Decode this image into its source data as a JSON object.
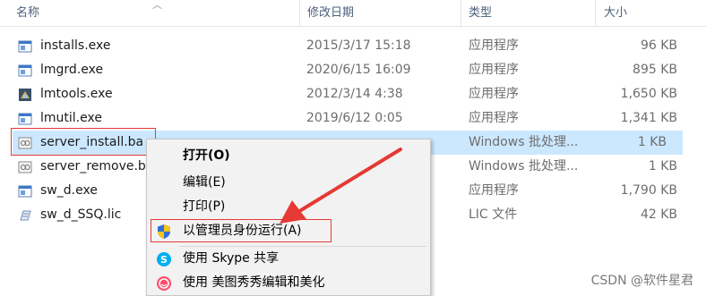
{
  "columns": {
    "name": "名称",
    "date": "修改日期",
    "type": "类型",
    "size": "大小"
  },
  "files": [
    {
      "name": "installs.exe",
      "date": "2015/3/17 15:18",
      "type": "应用程序",
      "size": "96 KB",
      "icon": "exe-icon"
    },
    {
      "name": "lmgrd.exe",
      "date": "2020/6/15 16:09",
      "type": "应用程序",
      "size": "895 KB",
      "icon": "exe-icon"
    },
    {
      "name": "lmtools.exe",
      "date": "2012/3/14 4:38",
      "type": "应用程序",
      "size": "1,650 KB",
      "icon": "lmtools-icon"
    },
    {
      "name": "lmutil.exe",
      "date": "2019/6/12 0:05",
      "type": "应用程序",
      "size": "1,341 KB",
      "icon": "exe-icon"
    },
    {
      "name": "server_install.ba",
      "date": "",
      "type": "Windows 批处理...",
      "size": "1 KB",
      "icon": "batch-file-icon",
      "selected": true
    },
    {
      "name": "server_remove.b",
      "date": "",
      "type": "Windows 批处理...",
      "size": "1 KB",
      "icon": "batch-file-icon"
    },
    {
      "name": "sw_d.exe",
      "date": "",
      "type": "应用程序",
      "size": "1,790 KB",
      "icon": "exe-icon"
    },
    {
      "name": "sw_d_SSQ.lic",
      "date": "",
      "type": "LIC 文件",
      "size": "42 KB",
      "icon": "lic-file-icon"
    }
  ],
  "context_menu": {
    "items": [
      {
        "label": "打开(O)",
        "bold": true
      },
      {
        "label": "编辑(E)"
      },
      {
        "label": "打印(P)"
      },
      {
        "label": "以管理员身份运行(A)",
        "icon": "uac-shield-icon"
      },
      {
        "label": "使用 Skype 共享",
        "icon": "skype-icon"
      },
      {
        "label": "使用 美图秀秀编辑和美化",
        "icon": "meitu-icon"
      }
    ]
  },
  "watermark": "CSDN @软件星君",
  "colors": {
    "selection": "#cce8ff",
    "annotation_red": "#e53935",
    "header_text": "#4c607a"
  }
}
